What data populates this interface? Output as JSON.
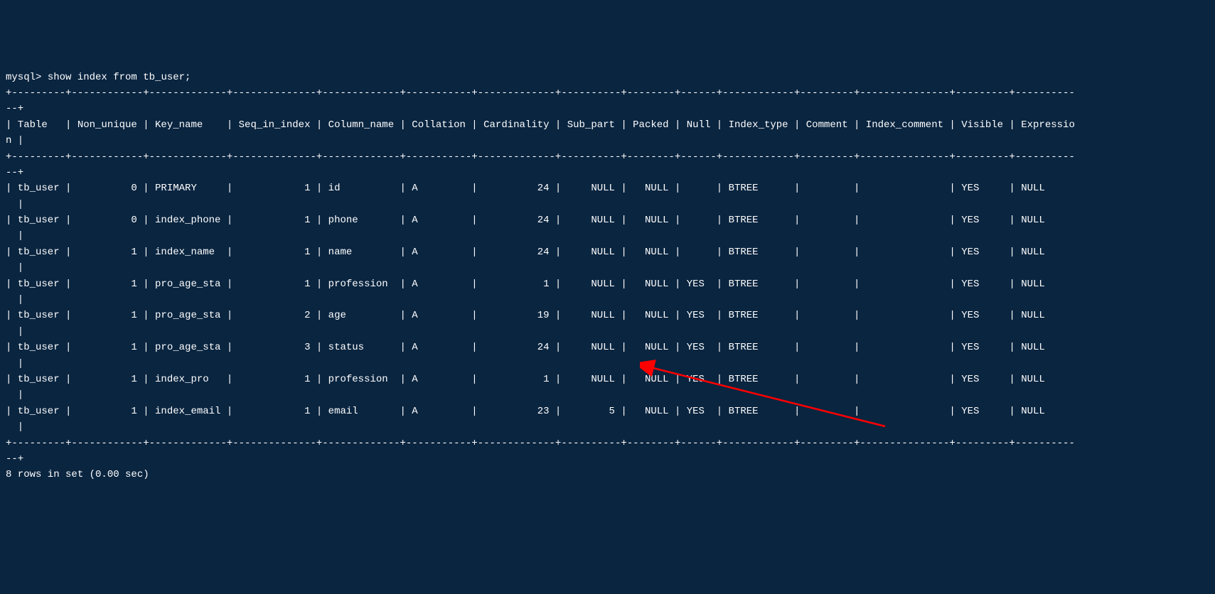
{
  "prompt": "mysql> ",
  "command": "show index from tb_user;",
  "separator_line": "+---------+------------+-------------+--------------+-------------+-----------+-------------+----------+--------+------+------------+---------+---------------+---------+----------\n--+",
  "header_line": "| Table   | Non_unique | Key_name    | Seq_in_index | Column_name | Collation | Cardinality | Sub_part | Packed | Null | Index_type | Comment | Index_comment | Visible | Expressio\nn |",
  "rows": [
    "| tb_user |          0 | PRIMARY     |            1 | id          | A         |          24 |     NULL |   NULL |      | BTREE      |         |               | YES     | NULL     \n  |",
    "| tb_user |          0 | index_phone |            1 | phone       | A         |          24 |     NULL |   NULL |      | BTREE      |         |               | YES     | NULL     \n  |",
    "| tb_user |          1 | index_name  |            1 | name        | A         |          24 |     NULL |   NULL |      | BTREE      |         |               | YES     | NULL     \n  |",
    "| tb_user |          1 | pro_age_sta |            1 | profession  | A         |           1 |     NULL |   NULL | YES  | BTREE      |         |               | YES     | NULL     \n  |",
    "| tb_user |          1 | pro_age_sta |            2 | age         | A         |          19 |     NULL |   NULL | YES  | BTREE      |         |               | YES     | NULL     \n  |",
    "| tb_user |          1 | pro_age_sta |            3 | status      | A         |          24 |     NULL |   NULL | YES  | BTREE      |         |               | YES     | NULL     \n  |",
    "| tb_user |          1 | index_pro   |            1 | profession  | A         |           1 |     NULL |   NULL | YES  | BTREE      |         |               | YES     | NULL     \n  |",
    "| tb_user |          1 | index_email |            1 | email       | A         |          23 |        5 |   NULL | YES  | BTREE      |         |               | YES     | NULL     \n  |"
  ],
  "footer": "8 rows in set (0.00 sec)",
  "chart_data": {
    "type": "table",
    "title": "MySQL SHOW INDEX FROM tb_user result",
    "columns": [
      "Table",
      "Non_unique",
      "Key_name",
      "Seq_in_index",
      "Column_name",
      "Collation",
      "Cardinality",
      "Sub_part",
      "Packed",
      "Null",
      "Index_type",
      "Comment",
      "Index_comment",
      "Visible",
      "Expression"
    ],
    "data": [
      [
        "tb_user",
        0,
        "PRIMARY",
        1,
        "id",
        "A",
        24,
        "NULL",
        "NULL",
        "",
        "BTREE",
        "",
        "",
        "YES",
        "NULL"
      ],
      [
        "tb_user",
        0,
        "index_phone",
        1,
        "phone",
        "A",
        24,
        "NULL",
        "NULL",
        "",
        "BTREE",
        "",
        "",
        "YES",
        "NULL"
      ],
      [
        "tb_user",
        1,
        "index_name",
        1,
        "name",
        "A",
        24,
        "NULL",
        "NULL",
        "",
        "BTREE",
        "",
        "",
        "YES",
        "NULL"
      ],
      [
        "tb_user",
        1,
        "pro_age_sta",
        1,
        "profession",
        "A",
        1,
        "NULL",
        "NULL",
        "YES",
        "BTREE",
        "",
        "",
        "YES",
        "NULL"
      ],
      [
        "tb_user",
        1,
        "pro_age_sta",
        2,
        "age",
        "A",
        19,
        "NULL",
        "NULL",
        "YES",
        "BTREE",
        "",
        "",
        "YES",
        "NULL"
      ],
      [
        "tb_user",
        1,
        "pro_age_sta",
        3,
        "status",
        "A",
        24,
        "NULL",
        "NULL",
        "YES",
        "BTREE",
        "",
        "",
        "YES",
        "NULL"
      ],
      [
        "tb_user",
        1,
        "index_pro",
        1,
        "profession",
        "A",
        1,
        "NULL",
        "NULL",
        "YES",
        "BTREE",
        "",
        "",
        "YES",
        "NULL"
      ],
      [
        "tb_user",
        1,
        "index_email",
        1,
        "email",
        "A",
        23,
        5,
        "NULL",
        "YES",
        "BTREE",
        "",
        "",
        "YES",
        "NULL"
      ]
    ]
  }
}
